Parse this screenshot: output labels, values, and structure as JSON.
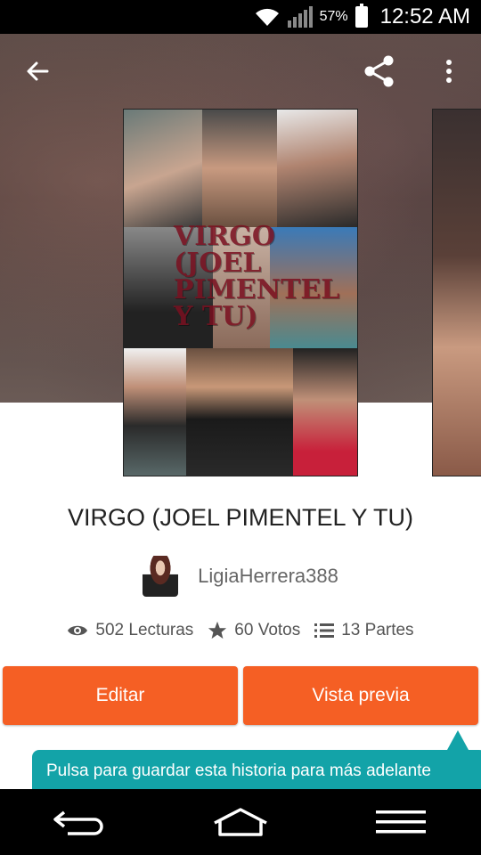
{
  "status_bar": {
    "battery_percent": "57%",
    "time": "12:52 AM"
  },
  "toolbar": {
    "back_icon": "arrow-left-icon",
    "share_icon": "share-icon",
    "more_icon": "more-vertical-icon"
  },
  "cover": {
    "title_text": "VIRGO (JOEL PIMENTEL Y TU)"
  },
  "story": {
    "title": "VIRGO (JOEL PIMENTEL Y TU)",
    "author": "LigiaHerrera388"
  },
  "stats": {
    "reads": "502 Lecturas",
    "votes": "60 Votos",
    "parts": "13 Partes"
  },
  "actions": {
    "edit_label": "Editar",
    "preview_label": "Vista previa"
  },
  "tooltip": {
    "text": "Pulsa para guardar esta historia para más adelante"
  },
  "colors": {
    "accent": "#f55f24",
    "tooltip": "#13a3a8"
  }
}
